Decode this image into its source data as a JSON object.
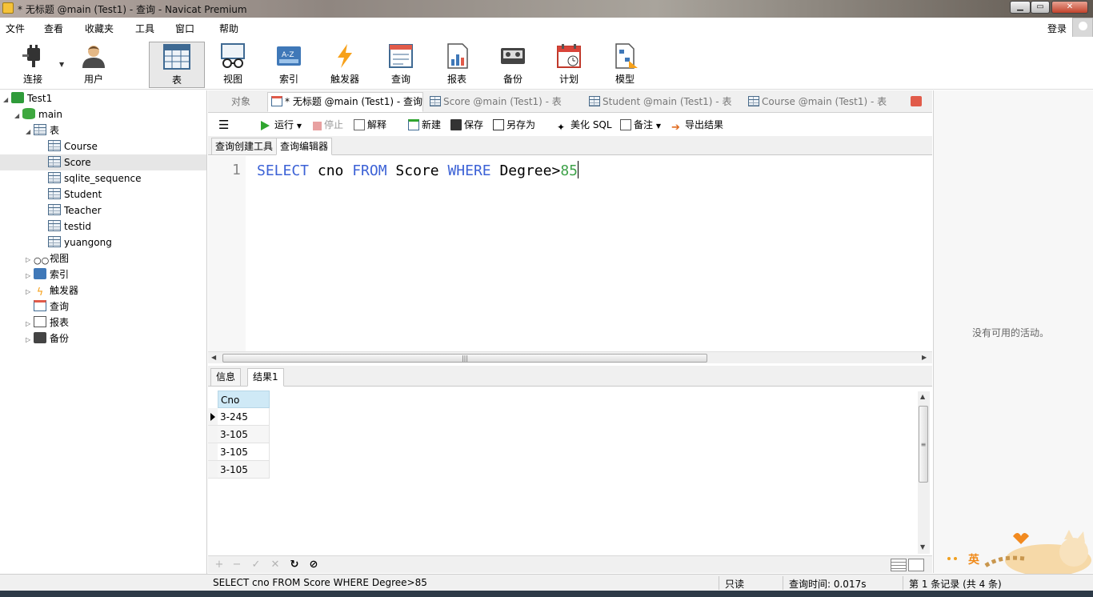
{
  "window": {
    "title": "* 无标题 @main (Test1) - 查询 - Navicat Premium"
  },
  "menu": {
    "items": [
      "文件",
      "查看",
      "收藏夹",
      "工具",
      "窗口",
      "帮助"
    ],
    "login": "登录"
  },
  "notification_badge": "63",
  "toolbar": {
    "buttons": [
      {
        "label": "连接",
        "icon": "plug-icon"
      },
      {
        "label": "用户",
        "icon": "user-icon"
      },
      {
        "label": "表",
        "icon": "table-icon",
        "active": true
      },
      {
        "label": "视图",
        "icon": "view-glasses-icon"
      },
      {
        "label": "索引",
        "icon": "index-icon"
      },
      {
        "label": "触发器",
        "icon": "lightning-icon"
      },
      {
        "label": "查询",
        "icon": "query-icon"
      },
      {
        "label": "报表",
        "icon": "report-icon"
      },
      {
        "label": "备份",
        "icon": "backup-icon"
      },
      {
        "label": "计划",
        "icon": "calendar-icon"
      },
      {
        "label": "模型",
        "icon": "model-icon"
      }
    ]
  },
  "tree": {
    "connection": "Test1",
    "database": "main",
    "tables_folder": "表",
    "tables": [
      "Course",
      "Score",
      "sqlite_sequence",
      "Student",
      "Teacher",
      "testid",
      "yuangong"
    ],
    "selected_table": "Score",
    "folders": [
      "视图",
      "索引",
      "触发器",
      "查询",
      "报表",
      "备份"
    ]
  },
  "doc_tabs": {
    "objects": "对象",
    "tabs": [
      "* 无标题 @main (Test1) - 查询",
      "Score @main (Test1) - 表",
      "Student @main (Test1) - 表",
      "Course @main (Test1) - 表"
    ]
  },
  "query_toolbar": {
    "run": "运行",
    "stop": "停止",
    "explain": "解释",
    "new": "新建",
    "save": "保存",
    "save_as": "另存为",
    "beautify": "美化 SQL",
    "comment": "备注",
    "export": "导出结果"
  },
  "sub_tabs": [
    "查询创建工具",
    "查询编辑器"
  ],
  "editor": {
    "line_number": "1",
    "tokens": [
      "SELECT",
      " cno ",
      "FROM",
      " Score ",
      "WHERE",
      " Degree>",
      "85"
    ]
  },
  "result_tabs": [
    "信息",
    "结果1"
  ],
  "grid": {
    "columns": [
      "Cno"
    ],
    "rows": [
      "3-245",
      "3-105",
      "3-105",
      "3-105"
    ]
  },
  "right_panel": {
    "empty_text": "没有可用的活动。"
  },
  "status": {
    "sql": "SELECT cno FROM Score WHERE Degree>85",
    "mode": "只读",
    "query_time": "查询时间: 0.017s",
    "record": "第 1 条记录 (共 4 条)"
  },
  "mascot_text": "英",
  "colors": {
    "keyword": "#3c62d6",
    "number": "#3fa24a",
    "grid_header": "#cfe9f6"
  }
}
